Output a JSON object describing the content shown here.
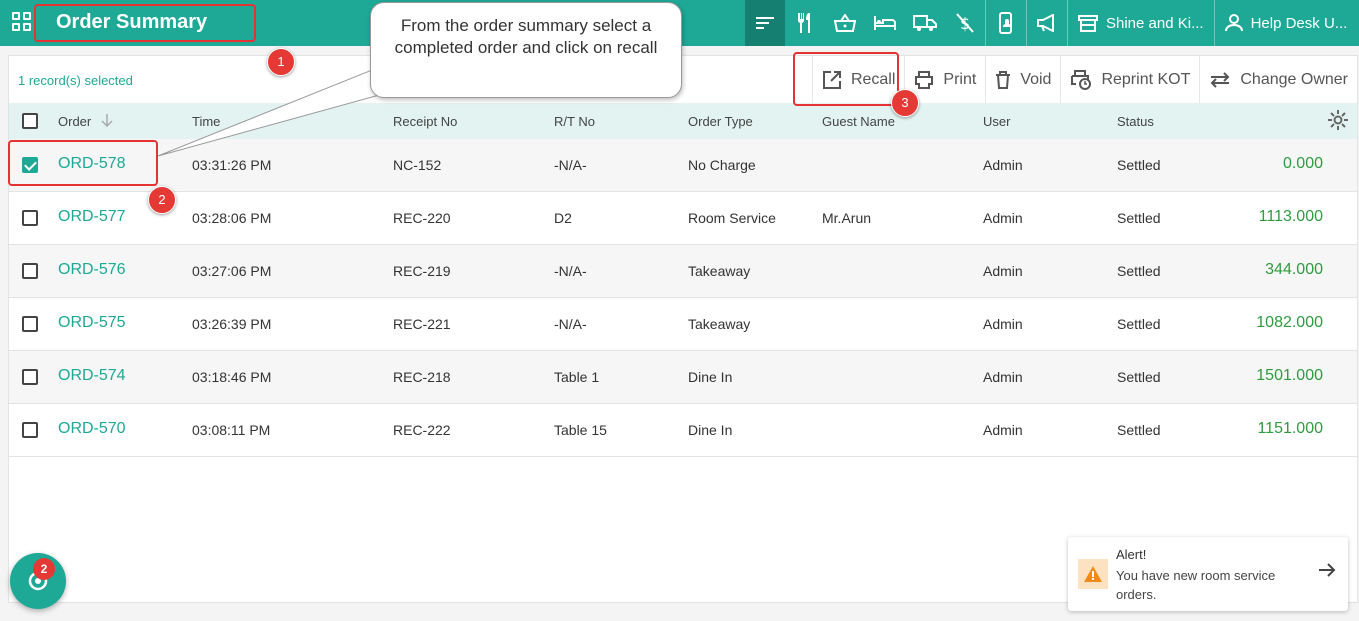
{
  "header": {
    "title": "Order Summary",
    "store_name": "Shine and Ki...",
    "user_name": "Help Desk U..."
  },
  "toolbar": {
    "selected_text": "1 record(s) selected",
    "recall_label": "Recall",
    "print_label": "Print",
    "void_label": "Void",
    "reprint_label": "Reprint KOT",
    "change_owner_label": "Change Owner"
  },
  "table": {
    "columns": {
      "order": "Order",
      "time": "Time",
      "receipt": "Receipt No",
      "rt": "R/T No",
      "type": "Order Type",
      "guest": "Guest Name",
      "user": "User",
      "status": "Status"
    },
    "rows": [
      {
        "order": "ORD-578",
        "time": "03:31:26 PM",
        "receipt": "NC-152",
        "rt": "-N/A-",
        "type": "No Charge",
        "guest": "",
        "user": "Admin",
        "status": "Settled",
        "amount": "0.000",
        "selected": true
      },
      {
        "order": "ORD-577",
        "time": "03:28:06 PM",
        "receipt": "REC-220",
        "rt": "D2",
        "type": "Room Service",
        "guest": "Mr.Arun",
        "user": "Admin",
        "status": "Settled",
        "amount": "1113.000",
        "selected": false
      },
      {
        "order": "ORD-576",
        "time": "03:27:06 PM",
        "receipt": "REC-219",
        "rt": "-N/A-",
        "type": "Takeaway",
        "guest": "",
        "user": "Admin",
        "status": "Settled",
        "amount": "344.000",
        "selected": false
      },
      {
        "order": "ORD-575",
        "time": "03:26:39 PM",
        "receipt": "REC-221",
        "rt": "-N/A-",
        "type": "Takeaway",
        "guest": "",
        "user": "Admin",
        "status": "Settled",
        "amount": "1082.000",
        "selected": false
      },
      {
        "order": "ORD-574",
        "time": "03:18:46 PM",
        "receipt": "REC-218",
        "rt": "Table 1",
        "type": "Dine In",
        "guest": "",
        "user": "Admin",
        "status": "Settled",
        "amount": "1501.000",
        "selected": false
      },
      {
        "order": "ORD-570",
        "time": "03:08:11 PM",
        "receipt": "REC-222",
        "rt": "Table 15",
        "type": "Dine In",
        "guest": "",
        "user": "Admin",
        "status": "Settled",
        "amount": "1151.000",
        "selected": false
      }
    ]
  },
  "annotations": {
    "callout_text": "From the order summary select a completed order and click on recall",
    "step1": "1",
    "step2": "2",
    "step3": "3"
  },
  "fab": {
    "badge_count": "2"
  },
  "alert": {
    "title": "Alert!",
    "message": "You have new room service orders."
  },
  "colors": {
    "brand": "#1ea896",
    "brand_dark": "#157f71",
    "amount_green": "#2e9b3f",
    "annotation_red": "#e53333"
  },
  "icons": [
    "apps-grid-icon",
    "sort-lines-icon",
    "restaurant-icon",
    "basket-icon",
    "bed-icon",
    "delivery-truck-icon",
    "no-charge-icon",
    "mobile-bell-icon",
    "megaphone-icon",
    "store-icon",
    "user-icon",
    "external-link-icon",
    "printer-icon",
    "trash-icon",
    "reprint-icon",
    "swap-arrows-icon",
    "settings-gear-icon",
    "sort-arrow-icon",
    "warning-icon",
    "arrow-right-icon"
  ]
}
